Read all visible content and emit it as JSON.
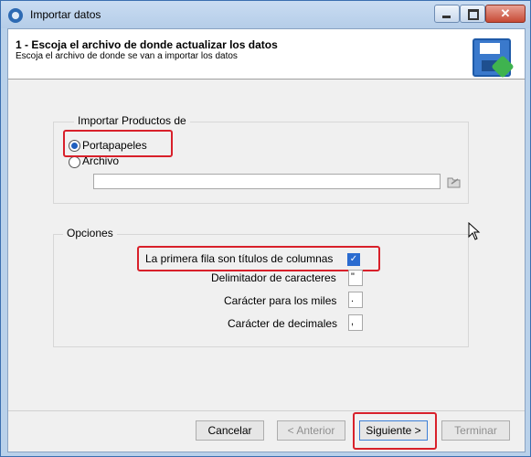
{
  "window": {
    "title": "Importar datos",
    "close_glyph": "✕"
  },
  "header": {
    "title": "1 - Escoja el archivo de donde actualizar los datos",
    "subtitle": "Escoja el archivo de donde se van a importar los datos",
    "icon": "floppy-disk-arrow-icon"
  },
  "import_group": {
    "legend": "Importar Productos de",
    "options": [
      {
        "label": "Portapapeles",
        "selected": true
      },
      {
        "label": "Archivo",
        "selected": false
      }
    ],
    "file_path_value": ""
  },
  "options_group": {
    "legend": "Opciones",
    "first_row_titles_label": "La primera fila son títulos de columnas",
    "first_row_titles_checked": true,
    "check_glyph": "✓",
    "delimiter_label": "Delimitador de caracteres",
    "delimiter_value": "\"",
    "thousands_label": "Carácter para los miles",
    "thousands_value": ".",
    "decimals_label": "Carácter de decimales",
    "decimals_value": ","
  },
  "footer": {
    "cancel": "Cancelar",
    "previous": "< Anterior",
    "next": "Siguiente >",
    "finish": "Terminar"
  },
  "colors": {
    "highlight": "#d8202a",
    "accent": "#1f5fbf"
  }
}
